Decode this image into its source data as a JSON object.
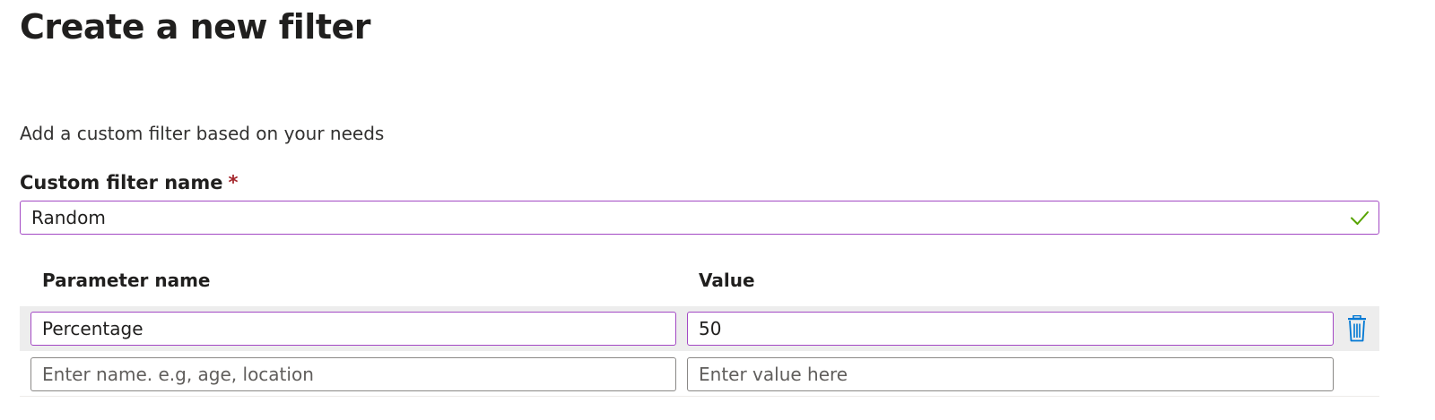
{
  "page": {
    "title": "Create a new filter",
    "description": "Add a custom filter based on your needs"
  },
  "filter_name": {
    "label": "Custom filter name",
    "required_marker": "*",
    "value": "Random",
    "status_icon": "checkmark-icon",
    "status_color": "#57a300"
  },
  "parameters": {
    "headers": {
      "name": "Parameter name",
      "value": "Value"
    },
    "rows": [
      {
        "name": "Percentage",
        "value": "50",
        "action_icon": "trash-icon"
      }
    ],
    "new_row": {
      "name_placeholder": "Enter name. e.g, age, location",
      "value_placeholder": "Enter value here"
    }
  },
  "colors": {
    "focus_border": "#a349c4",
    "default_border": "#8a8886",
    "row_highlight": "#ededed",
    "delete_icon": "#0078d4",
    "required_star": "#a4262c"
  }
}
